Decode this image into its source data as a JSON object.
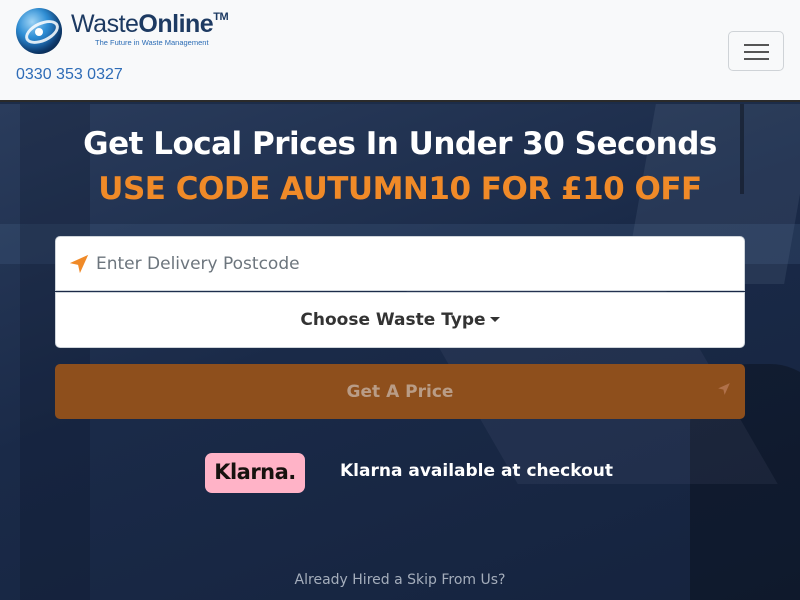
{
  "header": {
    "logo": {
      "name_regular": "Waste",
      "name_bold": "Online",
      "trademark": "TM",
      "tagline": "The Future in Waste Management"
    },
    "phone": "0330 353 0327",
    "menu_icon": "hamburger-menu-icon"
  },
  "hero": {
    "headline": "Get Local Prices In Under 30 Seconds",
    "promo": "USE CODE AUTUMN10 FOR £10 OFF",
    "postcode": {
      "placeholder": "Enter Delivery Postcode",
      "value": "",
      "icon": "location-arrow-icon"
    },
    "waste_type": {
      "label": "Choose Waste Type",
      "icon": "caret-down-icon"
    },
    "price_button": {
      "label": "Get A Price",
      "icon": "location-arrow-icon"
    },
    "klarna": {
      "logo": "Klarna.",
      "text": "Klarna available at checkout"
    },
    "hired_link": "Already Hired a Skip From Us?"
  },
  "colors": {
    "accent_orange": "#f08a28",
    "button_brown": "#8e4f1c",
    "link_blue": "#2e6cb7",
    "klarna_pink": "#ffb3c7",
    "hero_navy": "#1c2c48"
  }
}
